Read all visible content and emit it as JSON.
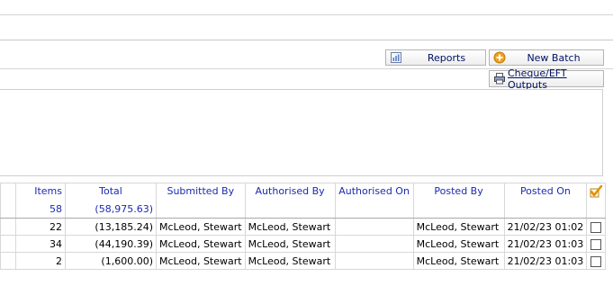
{
  "toolbar": {
    "reports_label": "Reports",
    "new_batch_label": "New Batch",
    "cheque_eft_label": "Cheque/EFT Outputs"
  },
  "grid": {
    "columns": {
      "items": "Items",
      "total": "Total",
      "submitted_by": "Submitted By",
      "authorised_by": "Authorised By",
      "authorised_on": "Authorised On",
      "posted_by": "Posted By",
      "posted_on": "Posted On"
    },
    "summary": {
      "items": "58",
      "total": "(58,975.63)"
    },
    "rows": [
      {
        "items": "22",
        "total": "(13,185.24)",
        "submitted_by": "McLeod, Stewart",
        "authorised_by": "McLeod, Stewart",
        "authorised_on": "",
        "posted_by": "McLeod, Stewart",
        "posted_on": "21/02/23 01:02",
        "checked": false
      },
      {
        "items": "34",
        "total": "(44,190.39)",
        "submitted_by": "McLeod, Stewart",
        "authorised_by": "McLeod, Stewart",
        "authorised_on": "",
        "posted_by": "McLeod, Stewart",
        "posted_on": "21/02/23 01:03",
        "checked": false
      },
      {
        "items": "2",
        "total": "(1,600.00)",
        "submitted_by": "McLeod, Stewart",
        "authorised_by": "McLeod, Stewart",
        "authorised_on": "",
        "posted_by": "McLeod, Stewart",
        "posted_on": "21/02/23 01:03",
        "checked": false
      }
    ]
  },
  "icons": {
    "reports": "report-icon",
    "new_batch": "add-circle-icon",
    "cheque_eft": "printer-icon",
    "select_column": "checkmark-icon"
  },
  "colors": {
    "header_text": "#1a2bb0",
    "button_text": "#001066",
    "add_icon": "#f0a020"
  }
}
